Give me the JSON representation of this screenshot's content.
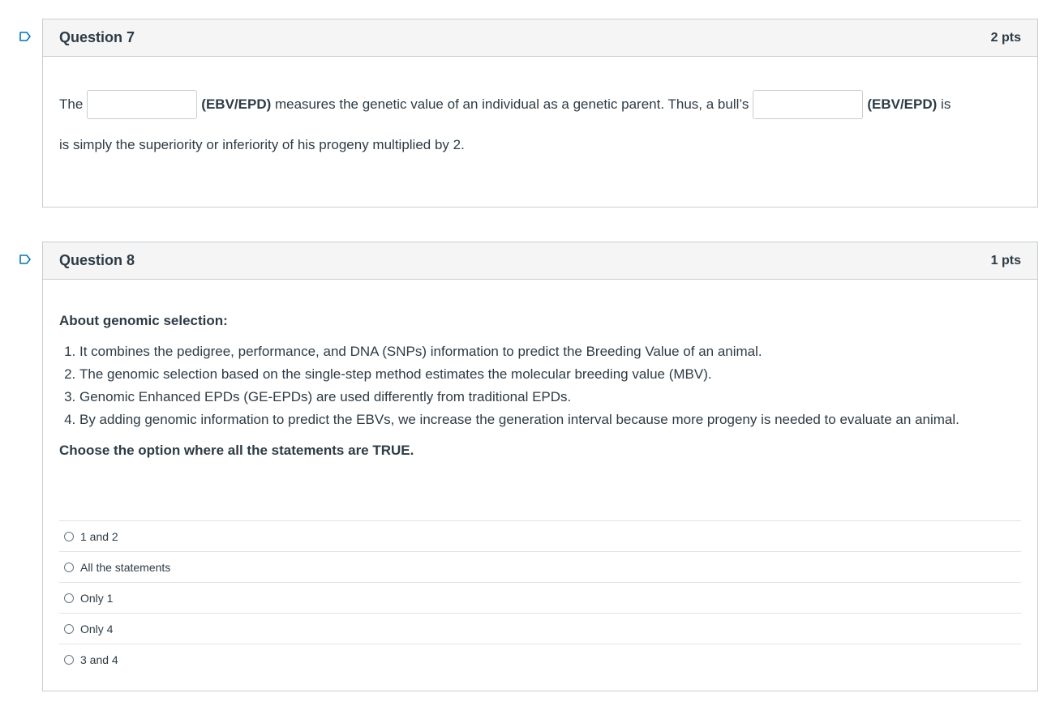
{
  "q7": {
    "title": "Question 7",
    "points": "2 pts",
    "text_before_blank1": "The",
    "blank1_value": "",
    "after_blank1_bold": "(EBV/EPD)",
    "after_blank1_rest": " measures the genetic value of an individual as a genetic parent. Thus, a bull’s",
    "blank2_value": "",
    "after_blank2_bold": "(EBV/EPD)",
    "after_blank2_rest": " is",
    "second_line": "is simply the superiority or inferiority of his progeny multiplied by 2."
  },
  "q8": {
    "title": "Question 8",
    "points": "1 pts",
    "intro": "About genomic selection:",
    "statements": [
      "It combines the pedigree, performance, and DNA (SNPs) information to predict the Breeding Value of an animal.",
      "The genomic selection based on the single-step method estimates the molecular breeding value (MBV).",
      "Genomic Enhanced EPDs (GE-EPDs) are used differently from traditional EPDs.",
      "By adding genomic information to predict the EBVs, we increase the generation interval because more progeny is needed to evaluate an animal."
    ],
    "prompt": "Choose the option where all the statements are TRUE.",
    "answers": [
      "1 and 2",
      "All the statements",
      "Only 1",
      "Only 4",
      "3 and 4"
    ]
  },
  "colors": {
    "border": "#c7cdd1",
    "header_bg": "#f5f5f5",
    "text": "#2d3b45",
    "flag_blue": "#0374b5"
  },
  "icons": {
    "flag": "flag-question-icon",
    "radio": "radio-button-icon"
  }
}
